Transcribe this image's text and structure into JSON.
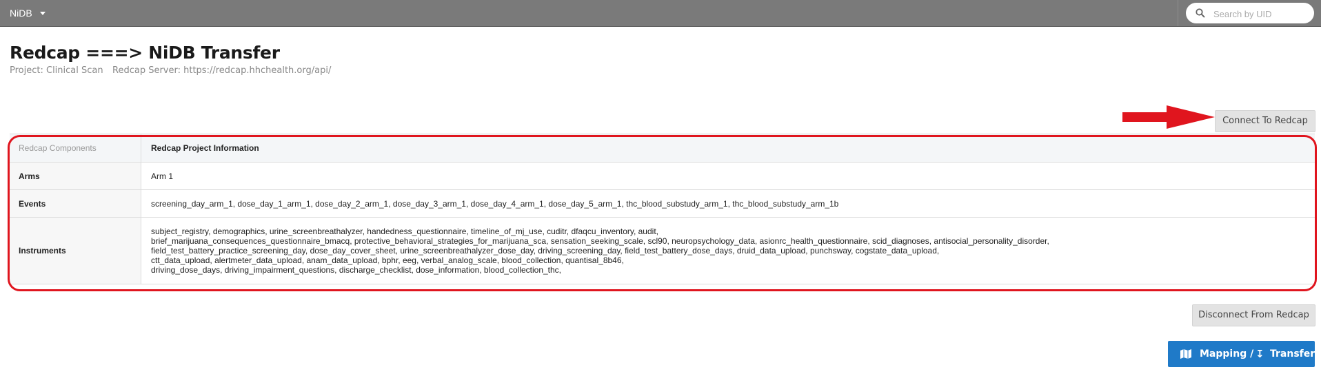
{
  "navbar": {
    "brand": "NiDB",
    "search_placeholder": "Search by UID"
  },
  "page": {
    "title": "Redcap ===> NiDB Transfer",
    "project_text": "Project: Clinical Scan",
    "server_text": "Redcap Server: https://redcap.hhchealth.org/api/"
  },
  "buttons": {
    "connect": "Connect To Redcap",
    "disconnect": "Disconnect From Redcap",
    "mapping": "Mapping /",
    "transfer": "Transfer"
  },
  "table": {
    "header_label": "Redcap Components",
    "header_value": "Redcap Project Information",
    "arms_label": "Arms",
    "arms_value": "Arm 1",
    "events_label": "Events",
    "events_value": "screening_day_arm_1, dose_day_1_arm_1, dose_day_2_arm_1, dose_day_3_arm_1, dose_day_4_arm_1, dose_day_5_arm_1, thc_blood_substudy_arm_1, thc_blood_substudy_arm_1b",
    "instruments_label": "Instruments",
    "instruments_lines": [
      "subject_registry, demographics, urine_screenbreathalyzer, handedness_questionnaire, timeline_of_mj_use, cuditr, dfaqcu_inventory, audit,",
      "brief_marijuana_consequences_questionnaire_bmacq, protective_behavioral_strategies_for_marijuana_sca, sensation_seeking_scale, scl90, neuropsychology_data, asionrc_health_questionnaire, scid_diagnoses, antisocial_personality_disorder,",
      "field_test_battery_practice_screening_day, dose_day_cover_sheet, urine_screenbreathalyzer_dose_day, driving_screening_day, field_test_battery_dose_days, druid_data_upload, punchsway, cogstate_data_upload,",
      "ctt_data_upload, alertmeter_data_upload, anam_data_upload, bphr, eeg, verbal_analog_scale, blood_collection, quantisal_8b46,",
      "driving_dose_days, driving_impairment_questions, discharge_checklist, dose_information, blood_collection_thc,"
    ]
  },
  "colors": {
    "navbar": "#7a7a7a",
    "primary_button": "#1f7ac8",
    "annotation_red": "#e0151e"
  },
  "icons": [
    "search-icon",
    "map-icon",
    "download-arrow-icon",
    "annotation-arrow"
  ]
}
